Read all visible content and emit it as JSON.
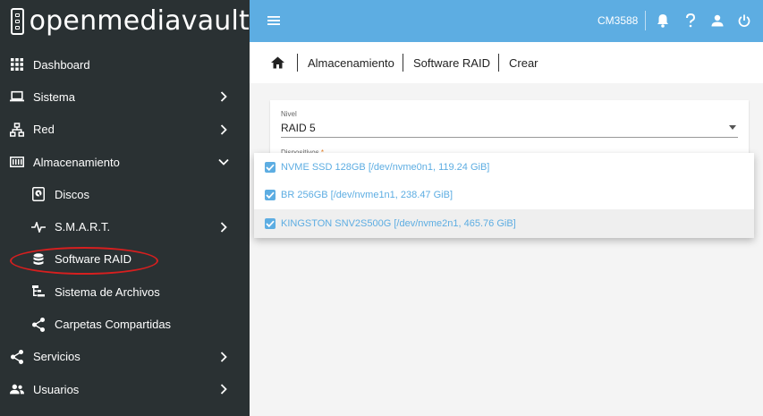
{
  "brand": {
    "name": "openmediavault"
  },
  "sidebar": {
    "items": [
      {
        "label": "Dashboard",
        "icon": "grid-icon",
        "sub": false,
        "chevron": ""
      },
      {
        "label": "Sistema",
        "icon": "laptop-icon",
        "sub": false,
        "chevron": "right"
      },
      {
        "label": "Red",
        "icon": "network-icon",
        "sub": false,
        "chevron": "right"
      },
      {
        "label": "Almacenamiento",
        "icon": "storage-icon",
        "sub": false,
        "chevron": "down"
      },
      {
        "label": "Discos",
        "icon": "disk-icon",
        "sub": true,
        "chevron": ""
      },
      {
        "label": "S.M.A.R.T.",
        "icon": "pulse-icon",
        "sub": true,
        "chevron": "right"
      },
      {
        "label": "Software RAID",
        "icon": "database-icon",
        "sub": true,
        "chevron": ""
      },
      {
        "label": "Sistema de Archivos",
        "icon": "filesystem-icon",
        "sub": true,
        "chevron": ""
      },
      {
        "label": "Carpetas Compartidas",
        "icon": "share-icon",
        "sub": true,
        "chevron": ""
      },
      {
        "label": "Servicios",
        "icon": "share-icon",
        "sub": false,
        "chevron": "right"
      },
      {
        "label": "Usuarios",
        "icon": "users-icon",
        "sub": false,
        "chevron": "right"
      }
    ]
  },
  "topbar": {
    "hostname": "CM3588"
  },
  "breadcrumb": {
    "items": [
      "Almacenamiento",
      "Software RAID",
      "Crear"
    ]
  },
  "form": {
    "level_label": "Nivel",
    "level_value": "RAID 5",
    "devices_label": "Dispositivos",
    "devices_required": "*"
  },
  "dropdown": {
    "options": [
      {
        "label": "NVME SSD 128GB [/dev/nvme0n1, 119.24 GiB]",
        "checked": true
      },
      {
        "label": "BR 256GB [/dev/nvme1n1, 238.47 GiB]",
        "checked": true
      },
      {
        "label": "KINGSTON SNV2S500G [/dev/nvme2n1, 465.76 GiB]",
        "checked": true
      }
    ]
  },
  "colors": {
    "accent": "#5dade2",
    "sidebar": "#2a3133",
    "highlight_circle": "#d61f1f"
  }
}
